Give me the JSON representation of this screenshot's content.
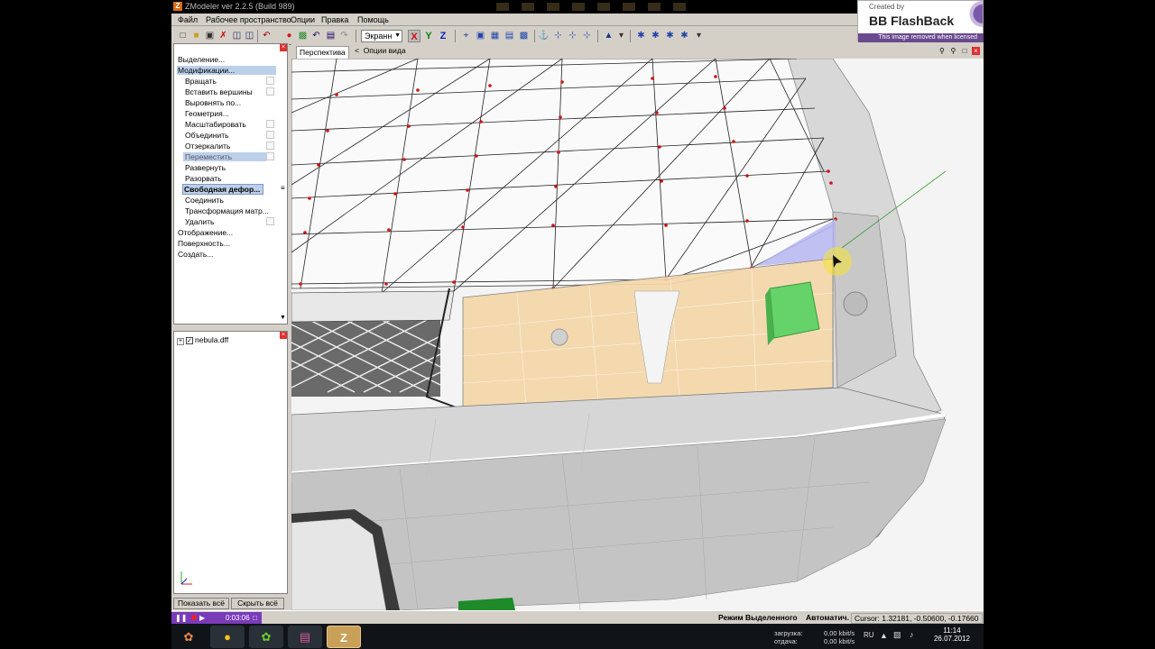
{
  "window": {
    "title": "ZModeler ver 2.2.5 (Build 989)",
    "app_icon": "Z"
  },
  "watermark": {
    "created_by": "Created by",
    "brand": "BB FlashBack",
    "notice": "This image removed when licensed"
  },
  "menu": [
    "Файл",
    "Рабочее пространство",
    "Опции",
    "Правка",
    "Помощь"
  ],
  "toolbar": {
    "view_select": "Экранн",
    "axes": {
      "x": "X",
      "y": "Y",
      "z": "Z"
    },
    "colors": {
      "x": "#d01010",
      "y": "#108010",
      "z": "#1020c0"
    }
  },
  "commands": {
    "items": [
      {
        "label": "Выделение...",
        "level": 0
      },
      {
        "label": "Модификации...",
        "level": 0,
        "state": "selected"
      },
      {
        "label": "Вращать",
        "level": 1,
        "check": true
      },
      {
        "label": "Вставить вершины",
        "level": 1,
        "check": true
      },
      {
        "label": "Выровнять по...",
        "level": 1
      },
      {
        "label": "Геометрия...",
        "level": 1
      },
      {
        "label": "Масштабировать",
        "level": 1,
        "check": true
      },
      {
        "label": "Объединить",
        "level": 1,
        "check": true
      },
      {
        "label": "Отзеркалить",
        "level": 1,
        "check": true
      },
      {
        "label": "Переместить",
        "level": 1,
        "check": true,
        "state": "selected"
      },
      {
        "label": "Развернуть",
        "level": 1
      },
      {
        "label": "Разорвать",
        "level": 1
      },
      {
        "label": "Свободная дефор...",
        "level": 1,
        "state": "active"
      },
      {
        "label": "Соединить",
        "level": 1
      },
      {
        "label": "Трансформация матр...",
        "level": 1
      },
      {
        "label": "Удалить",
        "level": 1,
        "check": true
      },
      {
        "label": "Отображение...",
        "level": 0
      },
      {
        "label": "Поверхность...",
        "level": 0
      },
      {
        "label": "Создать...",
        "level": 0
      }
    ]
  },
  "tree": {
    "file": "nebula.dff"
  },
  "buttons": {
    "show_all": "Показать всё",
    "hide_all": "Скрыть всё"
  },
  "viewport": {
    "tab": "Перспектива",
    "options": "Опции вида"
  },
  "status": {
    "timer": "0:03:06",
    "mode": "Режим Выделенного",
    "auto": "Автоматич.",
    "cursor": "Cursor: 1.32181, -0.50600, -0.17660"
  },
  "taskbar": {
    "download_label": "загрузка:",
    "upload_label": "отдача:",
    "download_value": "0,00 kbit/s",
    "upload_value": "0,00 kbit/s",
    "lang": "RU",
    "time": "11:14",
    "date": "26.07.2012"
  }
}
